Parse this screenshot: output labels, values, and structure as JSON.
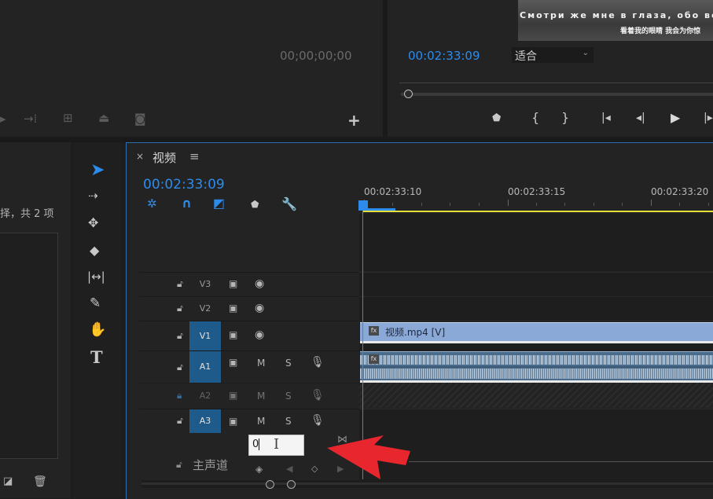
{
  "source_monitor": {
    "timecode": "00;00;00;00"
  },
  "program_monitor": {
    "timecode": "00:02:33:09",
    "zoom_select": "适合",
    "subtitle_ru": "Смотри же мне в глаза, обо все",
    "subtitle_zh": "看着我的眼睛 我会为你惊"
  },
  "project_panel": {
    "item_count": "择，共 2 项"
  },
  "timeline": {
    "close": "×",
    "title": "视频",
    "menu": "≡",
    "timecode": "00:02:33:09",
    "ruler": [
      "00:02:33:10",
      "00:02:33:15",
      "00:02:33:20"
    ],
    "tracks": [
      {
        "label": "V3",
        "type": "video",
        "selected": false
      },
      {
        "label": "V2",
        "type": "video",
        "selected": false
      },
      {
        "label": "V1",
        "type": "video",
        "selected": true
      },
      {
        "label": "A1",
        "type": "audio",
        "selected": true,
        "m": "M",
        "s": "S"
      },
      {
        "label": "A2",
        "type": "audio",
        "selected": false,
        "locked": true,
        "m": "M",
        "s": "S"
      },
      {
        "label": "A3",
        "type": "audio",
        "selected": true,
        "m": "M",
        "s": "S"
      }
    ],
    "master_track": "主声道",
    "volume_input": "0",
    "clip_video": "视频.mp4 [V]",
    "fx_badge": "fx"
  },
  "tools": [
    "selection-tool",
    "track-select-tool",
    "ripple-edit-tool",
    "razor-tool",
    "slip-tool",
    "pen-tool",
    "hand-tool",
    "type-tool"
  ],
  "colors": {
    "accent": "#2d8ceb",
    "video_clip": "#8aa9d6",
    "audio_clip": "#4a6c8c",
    "playhead": "#2d8ceb",
    "work_area": "#e5e03a",
    "arrow": "#e8262e"
  }
}
